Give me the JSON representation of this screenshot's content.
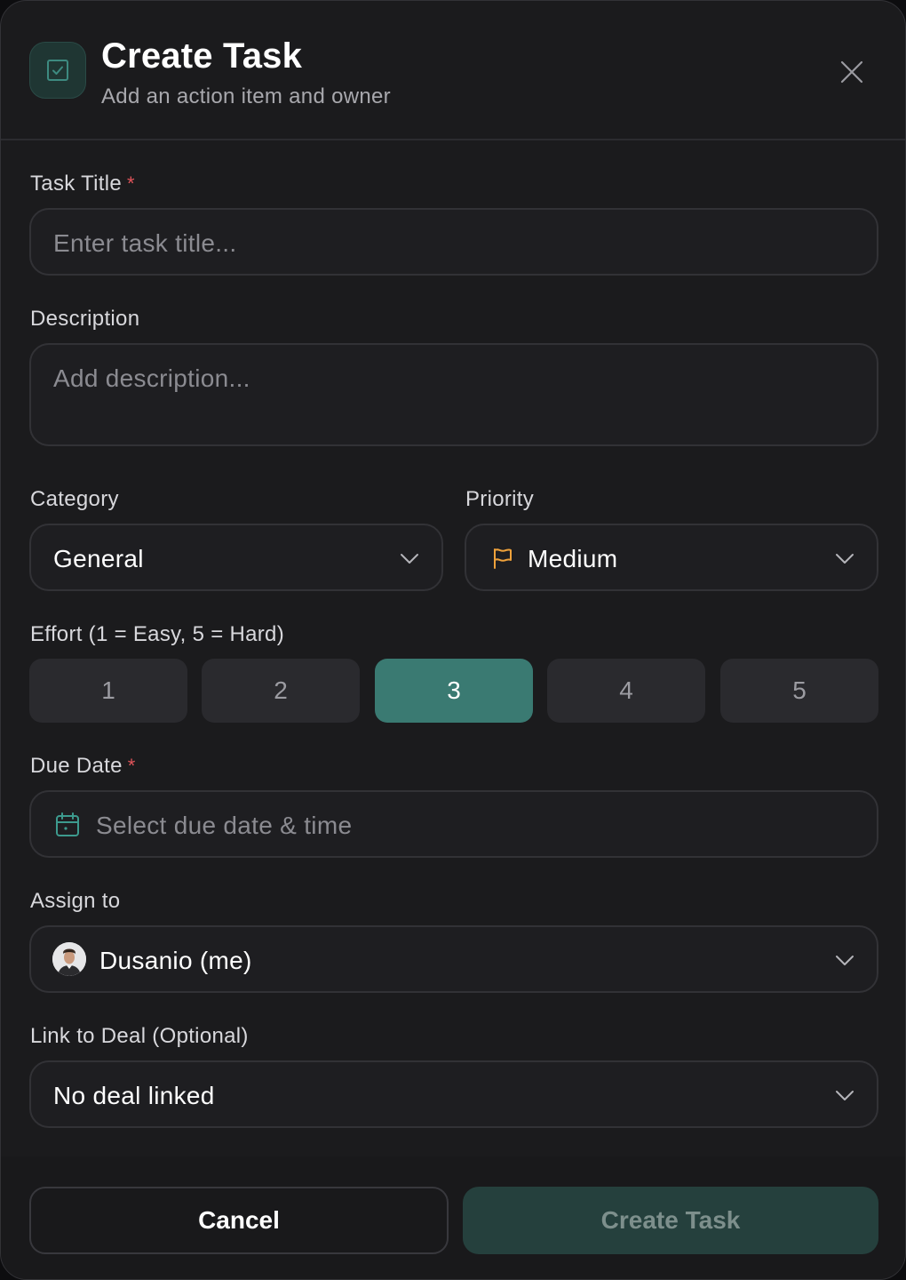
{
  "header": {
    "title": "Create Task",
    "subtitle": "Add an action item and owner",
    "icon": "checkbox-icon",
    "accent": "#3a7a72"
  },
  "form": {
    "task_title": {
      "label": "Task Title",
      "required": "*",
      "placeholder": "Enter task title..."
    },
    "description": {
      "label": "Description",
      "placeholder": "Add description..."
    },
    "category": {
      "label": "Category",
      "value": "General"
    },
    "priority": {
      "label": "Priority",
      "value": "Medium",
      "icon": "flag-icon",
      "icon_color": "#f0a23b"
    },
    "effort": {
      "label": "Effort (1 = Easy, 5 = Hard)",
      "options": [
        "1",
        "2",
        "3",
        "4",
        "5"
      ],
      "selected": "3"
    },
    "due_date": {
      "label": "Due Date",
      "required": "*",
      "placeholder": "Select due date & time",
      "icon": "calendar-icon"
    },
    "assign_to": {
      "label": "Assign to",
      "value": "Dusanio (me)"
    },
    "deal": {
      "label": "Link to Deal (Optional)",
      "value": "No deal linked"
    }
  },
  "footer": {
    "cancel_label": "Cancel",
    "create_label": "Create Task"
  }
}
